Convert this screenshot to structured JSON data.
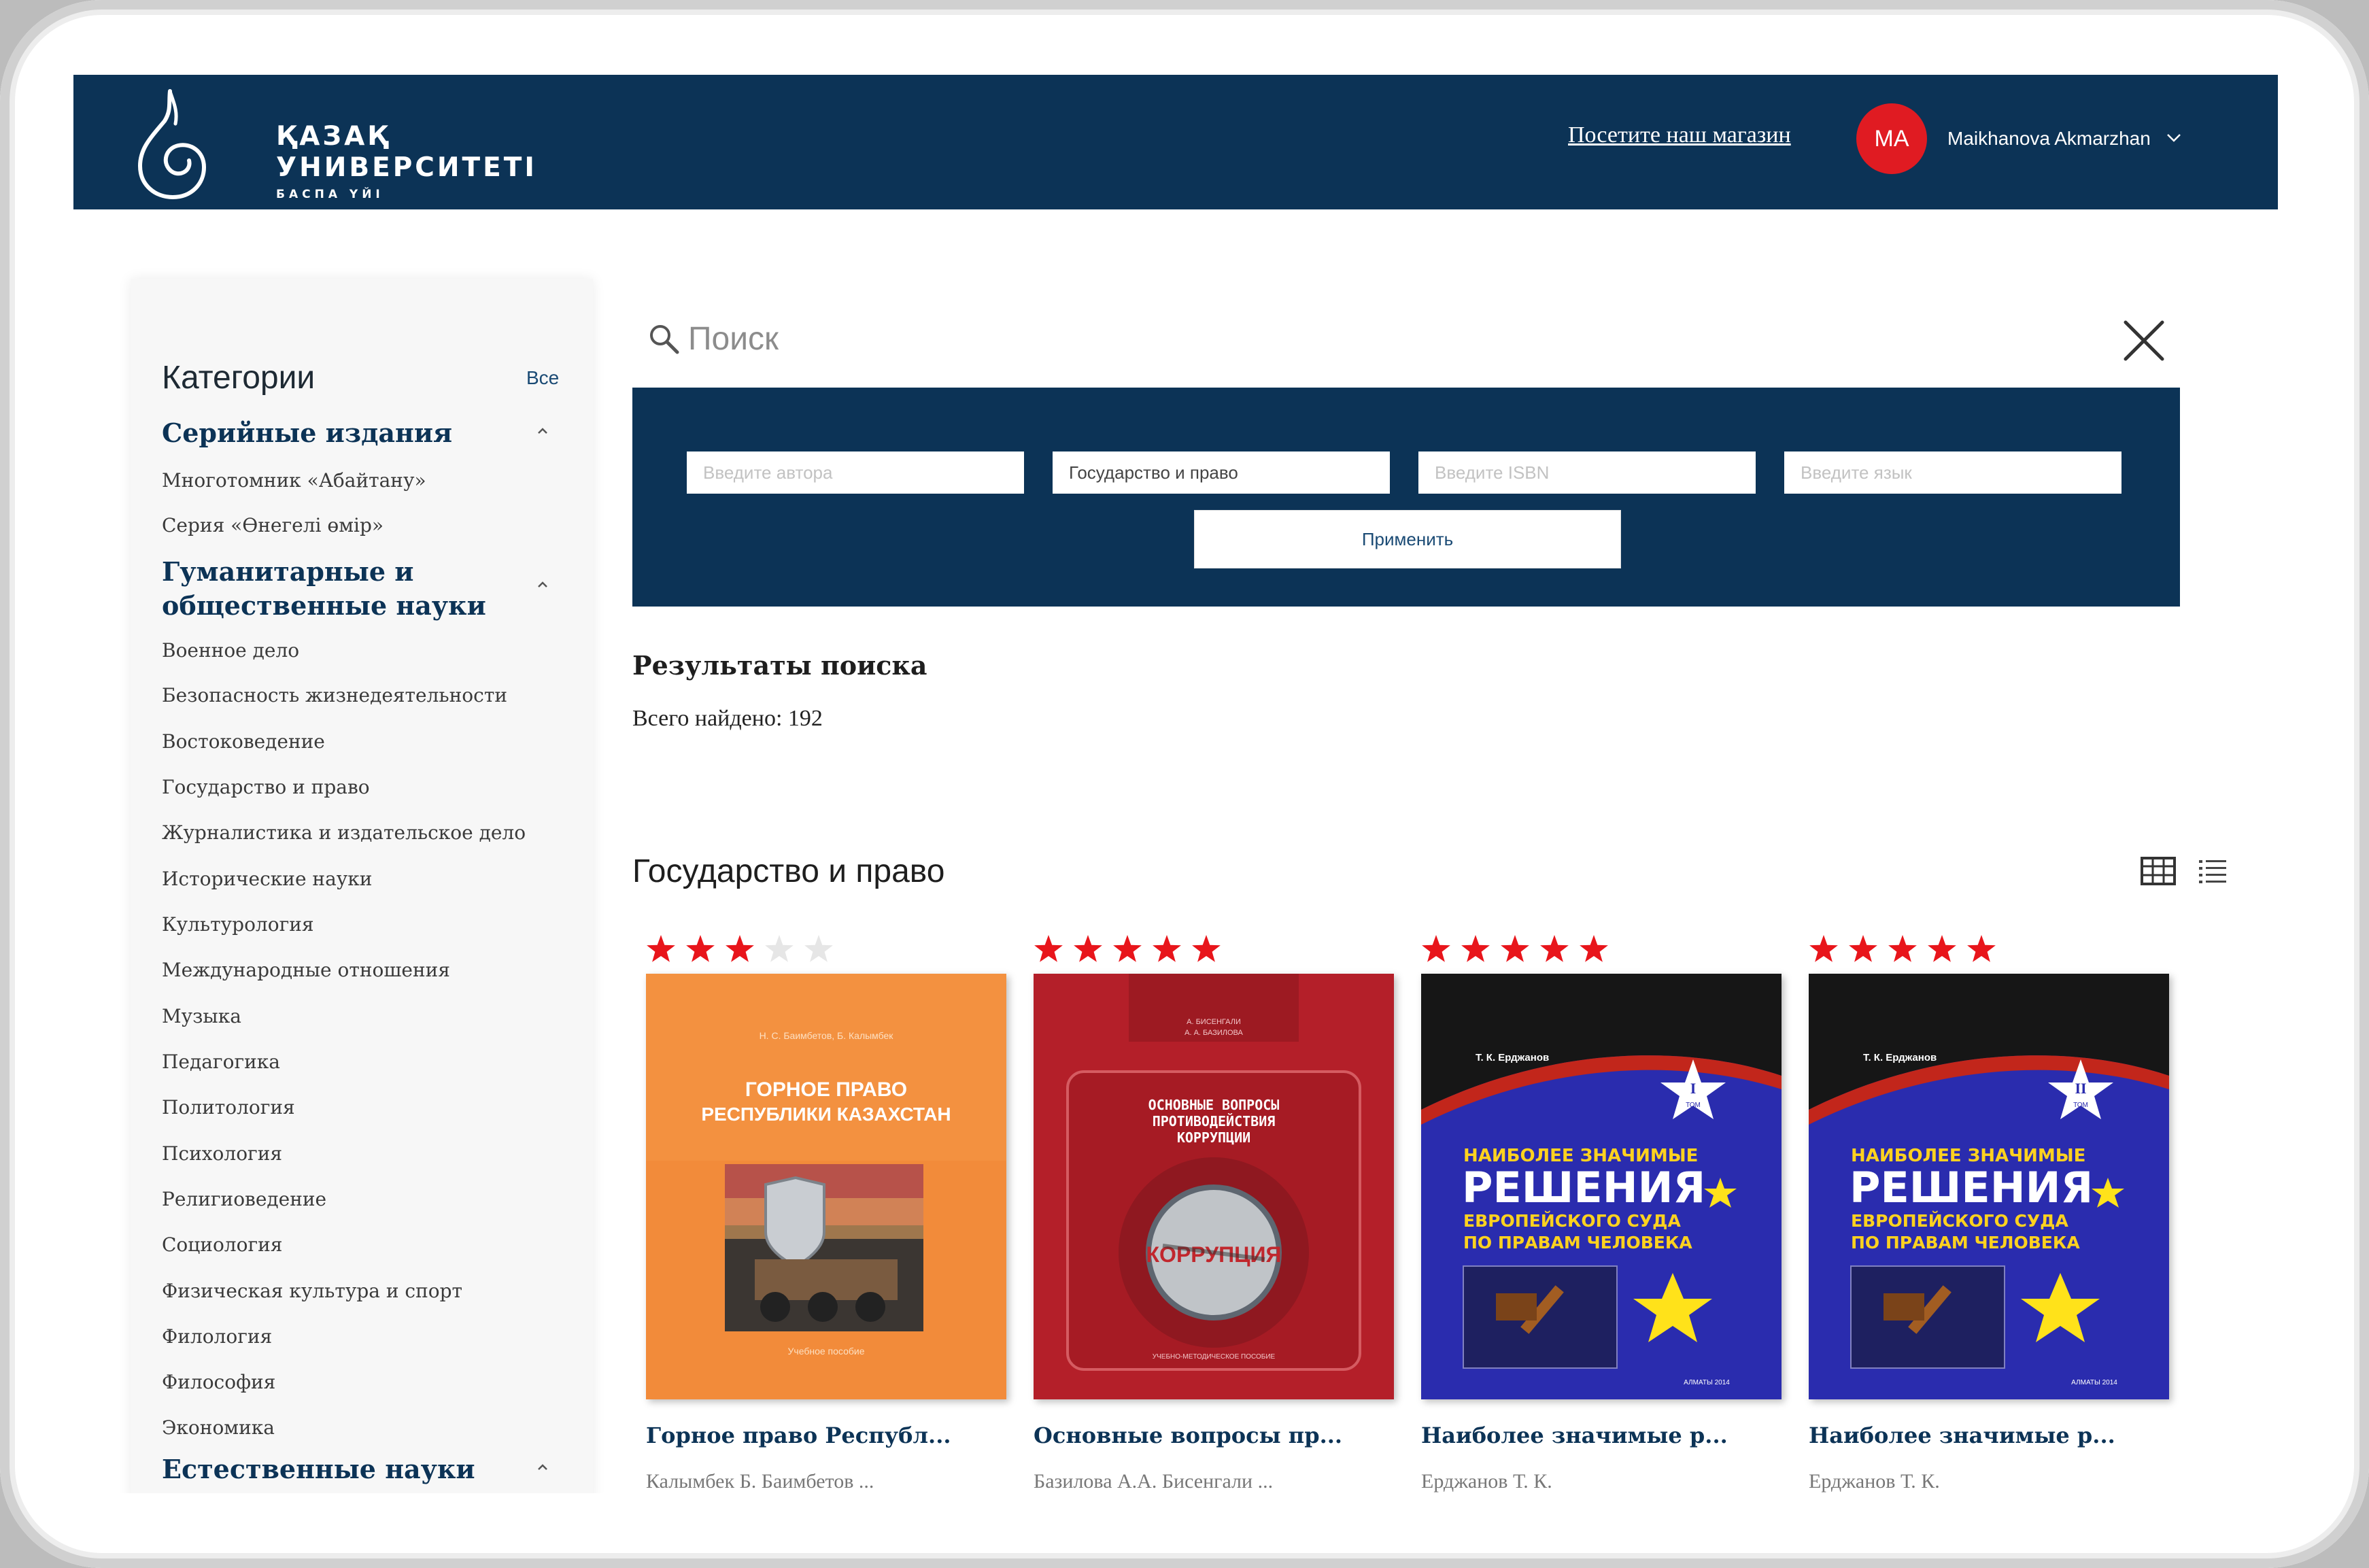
{
  "header": {
    "logo": {
      "line1": "ҚАЗАҚ",
      "line2": "УНИВЕРСИТЕТІ",
      "line3": "БАСПА ҮЙІ"
    },
    "store_link": "Посетите наш магазин",
    "user_initials": "MA",
    "user_name": "Maikhanova Akmarzhan"
  },
  "sidebar": {
    "title": "Категории",
    "all_link": "Все",
    "groups": [
      {
        "label": "Серийные издания",
        "items": [
          "Многотомник «Абайтану»",
          "Серия «Өнегелі өмір»"
        ]
      },
      {
        "label": "Гуманитарные и общественные науки",
        "items": [
          "Военное дело",
          "Безопасность жизнедеятельности",
          "Востоковедение",
          "Государство и право",
          "Журналистика и издательское дело",
          "Исторические науки",
          "Культурология",
          "Международные отношения",
          "Музыка",
          "Педагогика",
          "Политология",
          "Психология",
          "Религиоведение",
          "Социология",
          "Физическая культура и спорт",
          "Филология",
          "Философия",
          "Экономика"
        ]
      },
      {
        "label": "Естественные науки",
        "items": []
      }
    ]
  },
  "search": {
    "placeholder": "Поиск",
    "filters": {
      "author_placeholder": "Введите автора",
      "category_value": "Государство и право",
      "isbn_placeholder": "Введите ISBN",
      "language_placeholder": "Введите язык"
    },
    "apply_label": "Применить"
  },
  "results": {
    "title": "Результаты поиска",
    "count_text": "Всего найдено: 192"
  },
  "section": {
    "title": "Государство и право"
  },
  "books": [
    {
      "rating": 3,
      "title": "Горное право Республ...",
      "authors": "Калымбек Б.   Баимбетов ...",
      "cover": {
        "author": "Н. С. Баимбетов, Б. Калымбек",
        "title1": "ГОРНОЕ ПРАВО",
        "title2": "РЕСПУБЛИКИ КАЗАХСТАН",
        "footer": "Учебное пособие"
      }
    },
    {
      "rating": 5,
      "title": "Основные вопросы пр...",
      "authors": "Базилова А.А.   Бисенгали ...",
      "cover": {
        "author1": "А. БИСЕНГАЛИ",
        "author2": "А. А. БАЗИЛОВА",
        "title1": "ОСНОВНЫЕ ВОПРОСЫ",
        "title2": "ПРОТИВОДЕЙСТВИЯ",
        "title3": "КОРРУПЦИИ",
        "badge": "КОРРУПЦИЯ",
        "footer": "УЧЕБНО-МЕТОДИЧЕСКОЕ ПОСОБИЕ"
      }
    },
    {
      "rating": 5,
      "title": "Наиболее значимые р...",
      "authors": "Ерджанов Т. К.",
      "cover": {
        "author": "Т. К. Ерджанов",
        "volume": "I",
        "tom": "ТОМ",
        "title1": "НАИБОЛЕЕ ЗНАЧИМЫЕ",
        "title2": "РЕШЕНИЯ",
        "title3": "ЕВРОПЕЙСКОГО СУДА",
        "title4": "ПО ПРАВАМ ЧЕЛОВЕКА",
        "footer": "АЛМАТЫ 2014"
      }
    },
    {
      "rating": 5,
      "title": "Наиболее значимые р...",
      "authors": "Ерджанов Т. К.",
      "cover": {
        "author": "Т. К. Ерджанов",
        "volume": "II",
        "tom": "ТОМ",
        "title1": "НАИБОЛЕЕ ЗНАЧИМЫЕ",
        "title2": "РЕШЕНИЯ",
        "title3": "ЕВРОПЕЙСКОГО СУДА",
        "title4": "ПО ПРАВАМ ЧЕЛОВЕКА",
        "footer": "АЛМАТЫ 2014"
      }
    }
  ],
  "colors": {
    "header_bg": "#0c3356",
    "accent_red": "#e01b22",
    "star_on": "#e8151b",
    "star_off": "#e6e6e6"
  },
  "icons": [
    "logo-drop-icon",
    "chevron-down-icon",
    "search-icon",
    "close-icon",
    "grid-view-icon",
    "list-view-icon",
    "star-icon"
  ]
}
